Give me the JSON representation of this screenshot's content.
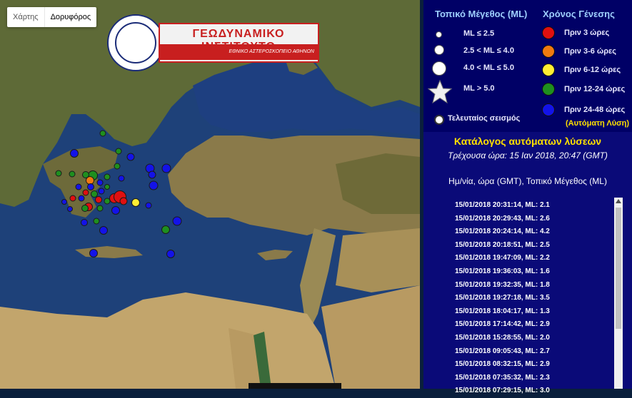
{
  "map": {
    "toggle": {
      "map_label": "Χάρτης",
      "satellite_label": "Δορυφόρος"
    },
    "logo": {
      "title": "ΓΕΩΔΥΝΑΜΙΚΟ ΙΝΣΤΙΤΟΥΤΟ",
      "subtitle": "ΕΘΝΙΚΟ ΑΣΤΕΡΟΣΚΟΠΕΙΟ ΑΘΗΝΩΝ"
    },
    "colors": {
      "sea": "#1d3f7a",
      "land": "#6b6b3b",
      "red": "#e01010",
      "orange": "#f07a10",
      "yellow": "#ffee33",
      "green": "#1f8f1f",
      "blue": "#1313e8"
    }
  },
  "legend": {
    "magnitude_title": "Τοπικό Μέγεθος (ML)",
    "time_title": "Χρόνος Γένεσης",
    "magnitudes": [
      "ML ≤ 2.5",
      "2.5 < ML ≤ 4.0",
      "4.0 < ML ≤ 5.0",
      "ML > 5.0"
    ],
    "latest": "Τελευταίος σεισμός",
    "ages": [
      "Πριν 3 ώρες",
      "Πριν 3-6 ώρες",
      "Πριν 6-12 ώρες",
      "Πριν 12-24 ώρες",
      "Πριν 24-48 ώρες"
    ],
    "automatic": "(Αυτόματη Λύση)"
  },
  "catalog": {
    "title": "Κατάλογος αυτόματων λύσεων",
    "current_time": "Τρέχουσα ώρα: 15 Ιαν 2018, 20:47 (GMT)",
    "header": "Ημ/νία, ώρα (GMT), Τοπικό Μέγεθος (ML)",
    "rows": [
      "15/01/2018   20:31:14,   ML: 2.1",
      "15/01/2018   20:29:43,   ML: 2.6",
      "15/01/2018   20:24:14,   ML: 4.2",
      "15/01/2018   20:18:51,   ML: 2.5",
      "15/01/2018   19:47:09,   ML: 2.2",
      "15/01/2018   19:36:03,   ML: 1.6",
      "15/01/2018   19:32:35,   ML: 1.8",
      "15/01/2018   19:27:18,   ML: 3.5",
      "15/01/2018   18:04:17,   ML: 1.3",
      "15/01/2018   17:14:42,   ML: 2.9",
      "15/01/2018   15:28:55,   ML: 2.0",
      "15/01/2018   09:05:43,   ML: 2.7",
      "15/01/2018   08:32:15,   ML: 2.9",
      "15/01/2018   07:35:32,   ML: 2.3",
      "15/01/2018   07:29:15,   ML: 3.0"
    ]
  }
}
